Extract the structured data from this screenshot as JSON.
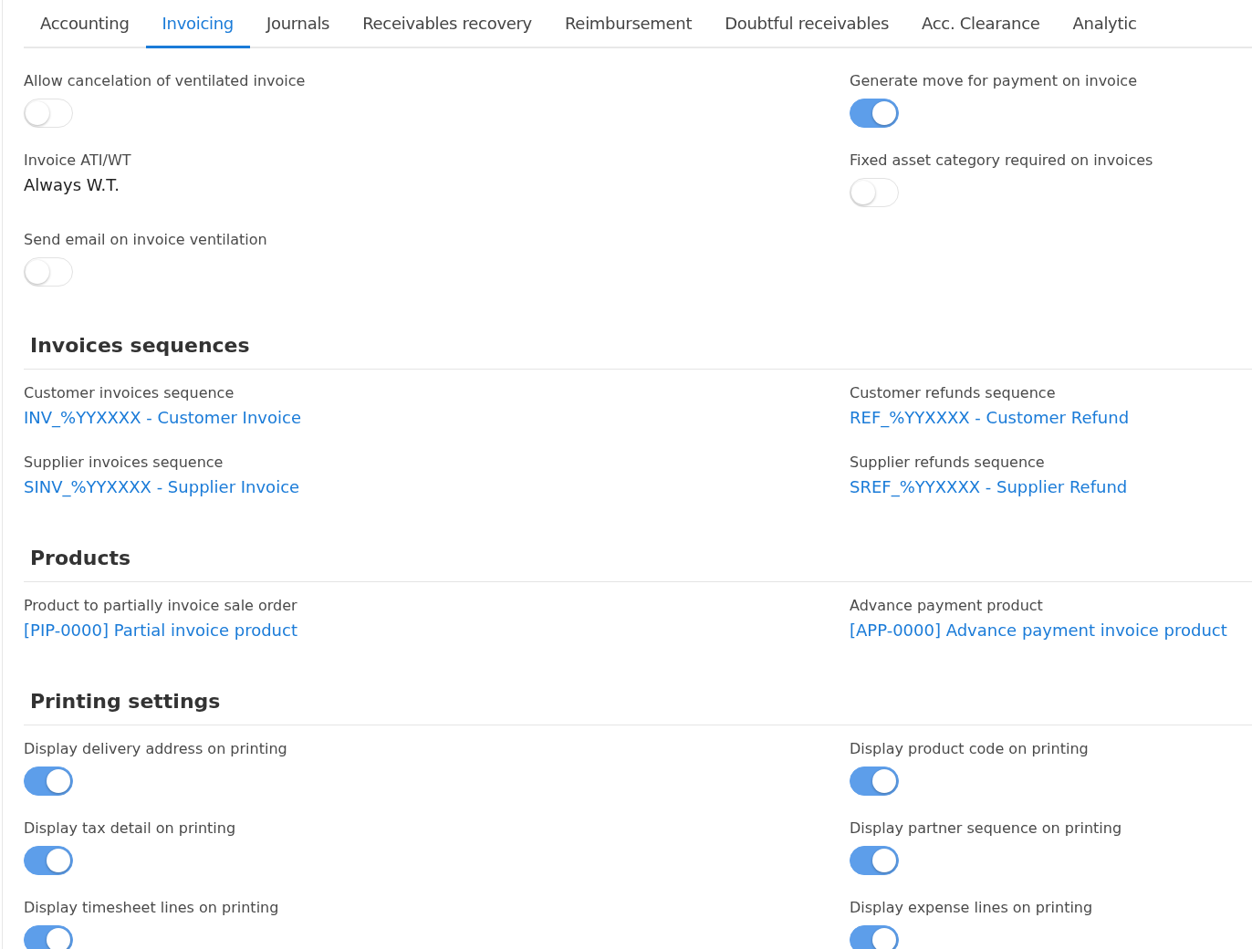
{
  "tabs": [
    {
      "label": "Accounting",
      "selected": false
    },
    {
      "label": "Invoicing",
      "selected": true
    },
    {
      "label": "Journals",
      "selected": false
    },
    {
      "label": "Receivables recovery",
      "selected": false
    },
    {
      "label": "Reimbursement",
      "selected": false
    },
    {
      "label": "Doubtful receivables",
      "selected": false
    },
    {
      "label": "Acc. Clearance",
      "selected": false
    },
    {
      "label": "Analytic",
      "selected": false
    }
  ],
  "sections": [
    {
      "left": [
        {
          "kind": "toggle",
          "label": "Allow cancelation of ventilated invoice",
          "on": false
        },
        {
          "kind": "text",
          "label": "Invoice ATI/WT",
          "value": "Always W.T."
        },
        {
          "kind": "toggle",
          "label": "Send email on invoice ventilation",
          "on": false
        }
      ],
      "right": [
        {
          "kind": "toggle",
          "label": "Generate move for payment on invoice",
          "on": true
        },
        {
          "kind": "toggle",
          "label": "Fixed asset category required on invoices",
          "on": false
        }
      ]
    },
    {
      "title": "Invoices sequences",
      "left": [
        {
          "kind": "link",
          "label": "Customer invoices sequence",
          "value": "INV_%YYXXXX - Customer Invoice"
        },
        {
          "kind": "link",
          "label": "Supplier invoices sequence",
          "value": "SINV_%YYXXXX - Supplier Invoice"
        }
      ],
      "right": [
        {
          "kind": "link",
          "label": "Customer refunds sequence",
          "value": "REF_%YYXXXX - Customer Refund"
        },
        {
          "kind": "link",
          "label": "Supplier refunds sequence",
          "value": "SREF_%YYXXXX - Supplier Refund"
        }
      ]
    },
    {
      "title": "Products",
      "left": [
        {
          "kind": "link",
          "label": "Product to partially invoice sale order",
          "value": "[PIP-0000] Partial invoice product"
        }
      ],
      "right": [
        {
          "kind": "link",
          "label": "Advance payment product",
          "value": "[APP-0000] Advance payment invoice product"
        }
      ]
    },
    {
      "title": "Printing settings",
      "left": [
        {
          "kind": "toggle",
          "label": "Display delivery address on printing",
          "on": true
        },
        {
          "kind": "toggle",
          "label": "Display tax detail on printing",
          "on": true
        },
        {
          "kind": "toggle",
          "label": "Display timesheet lines on printing",
          "on": true
        }
      ],
      "right": [
        {
          "kind": "toggle",
          "label": "Display product code on printing",
          "on": true
        },
        {
          "kind": "toggle",
          "label": "Display partner sequence on printing",
          "on": true
        },
        {
          "kind": "toggle",
          "label": "Display expense lines on printing",
          "on": true
        }
      ]
    }
  ]
}
